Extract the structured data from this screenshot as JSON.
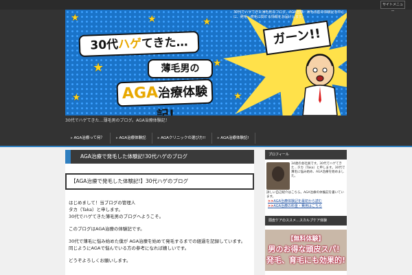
{
  "topbar": {
    "menu_button": "サイトメニュー"
  },
  "banner": {
    "title_line1_prefix": "30代",
    "title_line1_highlight": "ハゲ",
    "title_line1_suffix": "てきた…",
    "title_line2": "薄毛男の",
    "title_line3_highlight": "AGA",
    "title_line3_suffix": "治療体験記!",
    "exclaim": "ガーン!!"
  },
  "header": {
    "description": "30代でハゲてきた薄毛男のブログ。AGA治療・薄毛改善の体験記を中心に、発毛・育毛に関する情報をお届けします。",
    "tagline": "30代でハゲてきた…薄毛男のブログ。AGA治療体験記！"
  },
  "nav": {
    "items": [
      "AGA治療って何？",
      "AGA治療体験記",
      "AGAクリニックの選び方!!",
      "AGA治療体験記!"
    ]
  },
  "article": {
    "title": "AGA治療で発毛した体験記!30代ハゲのブログ",
    "intro_box": "【AGA治療で発毛した体験記!】30代ハゲのブログ",
    "paragraphs": [
      "はじめまして！当ブログの管理人",
      "タカ（Taka）と申します。",
      "30代でハゲてきた薄毛男のブログへようこそ。",
      "このブログはAGA治療の体験記です。",
      "30代で薄毛に悩み始めた僕が AGA治療を始めて発毛するまでの経過を記録しています。",
      "同じようにAGAで悩んでいる方の参考になれば嬉しいです。",
      "どうぞよろしくお願いします。"
    ]
  },
  "sidebar": {
    "profile_heading": "プロフィール",
    "profile_text": "34歳の会社員です。30代でハゲてきた…タカ（Taka）と申します。30代で薄毛に悩み始め、AGA治療を始めました。",
    "profile_note": "詳しい自己紹介はこちら。AGA治療の体験記を書いています。",
    "links": [
      {
        "arrow": ">>",
        "label": "AGA治療体験記を最初から読む"
      },
      {
        "arrow": ">>",
        "label": "AGA治療の料金・費用はこちら"
      }
    ],
    "promo_heading": "頭皮ケアのススメ…スカルプケア体験",
    "promo": {
      "line1": "【無料体験】",
      "line2": "男のお得な頭皮スパ！",
      "line3": "発毛、育毛にも効果的!"
    }
  },
  "colors": {
    "accent": "#2f7fc0",
    "banner_blue": "#1a73c8",
    "burst_yellow": "#ffe14a",
    "dark": "#333333"
  }
}
